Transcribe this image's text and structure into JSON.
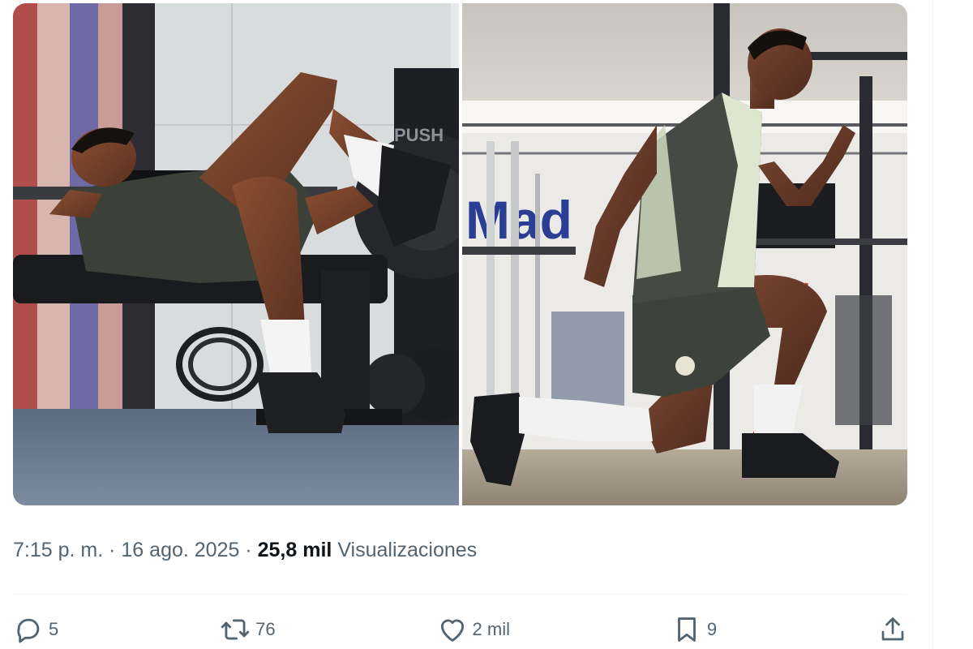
{
  "tweet": {
    "timestamp": "7:15 p. m.",
    "date": "16 ago. 2025",
    "dot": "·",
    "views_count": "25,8 mil",
    "views_label": "Visualizaciones"
  },
  "media": {
    "photo_left_text": "PUSH",
    "photo_right_wall_text": "Mad"
  },
  "actions": {
    "reply": {
      "icon": "reply-icon",
      "count": "5"
    },
    "repost": {
      "icon": "repost-icon",
      "count": "76"
    },
    "like": {
      "icon": "heart-icon",
      "count": "2 mil"
    },
    "bookmark": {
      "icon": "bookmark-icon",
      "count": "9"
    },
    "share": {
      "icon": "share-icon"
    }
  },
  "colors": {
    "secondary_text": "#536471",
    "primary_text": "#0f1419",
    "divider": "#eff3f4"
  }
}
